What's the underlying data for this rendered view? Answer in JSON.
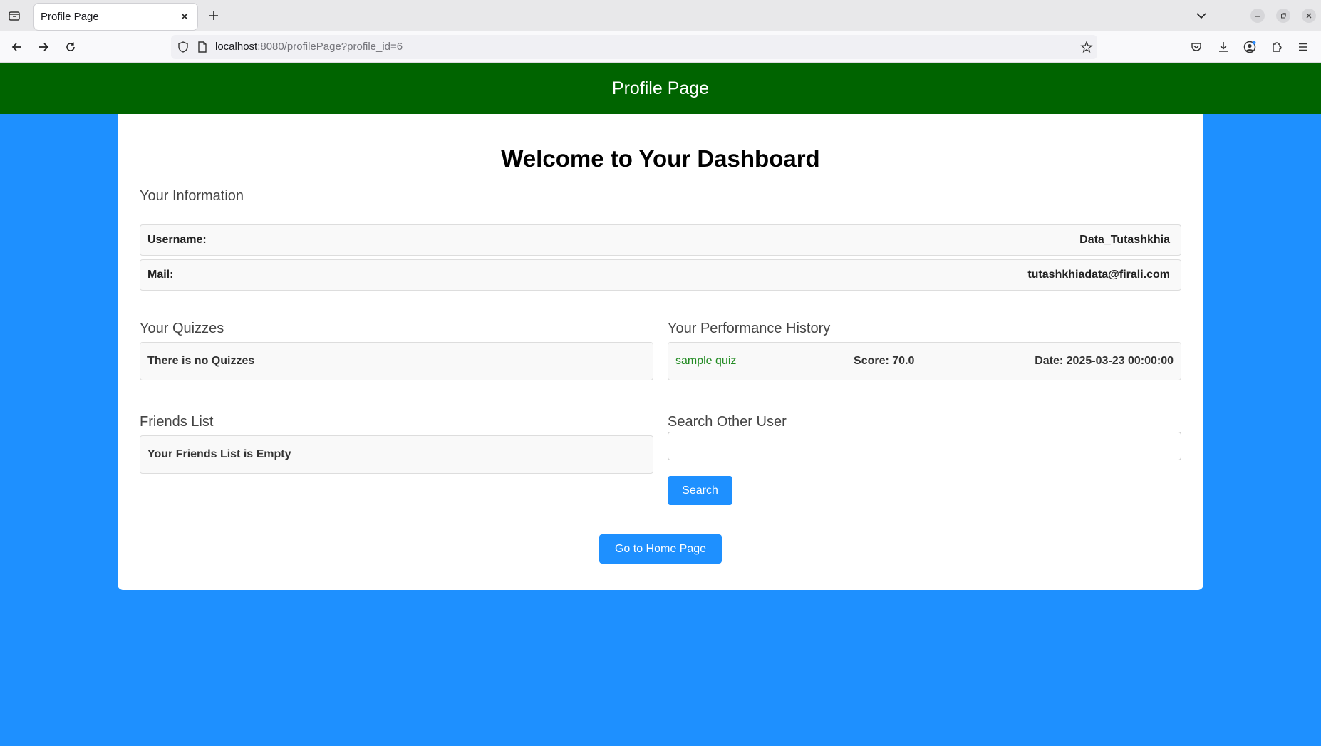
{
  "browser": {
    "tab_title": "Profile Page",
    "url_host": "localhost",
    "url_rest": ":8080/profilePage?profile_id=6"
  },
  "header": {
    "title": "Profile Page"
  },
  "dashboard": {
    "title": "Welcome to Your Dashboard",
    "info_heading": "Your Information",
    "username_label": "Username:",
    "username_value": "Data_Tutashkhia",
    "mail_label": "Mail:",
    "mail_value": "tutashkhiadata@firali.com",
    "quizzes_heading": "Your Quizzes",
    "quizzes_empty": "There is no Quizzes",
    "performance_heading": "Your Performance History",
    "performance": [
      {
        "quiz": "sample quiz",
        "score": "Score: 70.0",
        "date": "Date: 2025-03-23 00:00:00"
      }
    ],
    "friends_heading": "Friends List",
    "friends_empty": "Your Friends List is Empty",
    "search_heading": "Search Other User",
    "search_value": "",
    "search_button": "Search",
    "home_button": "Go to Home Page"
  },
  "colors": {
    "background": "#1e90ff",
    "header": "#006400",
    "button": "#1e90ff",
    "link": "#228b22"
  }
}
